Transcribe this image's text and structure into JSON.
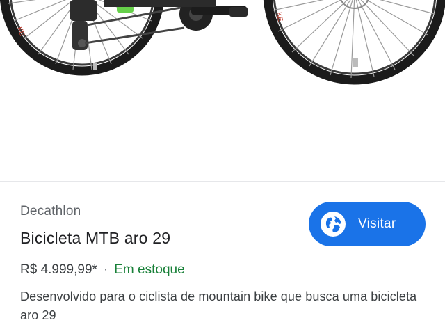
{
  "product": {
    "merchant": "Decathlon",
    "title": "Bicicleta MTB aro 29",
    "price": "R$ 4.999,99*",
    "separator": "·",
    "stock_status": "Em estoque",
    "description": "Desenvolvido para o ciclista de mountain bike que busca uma bicicleta aro 29"
  },
  "visit_button": {
    "label": "Visitar",
    "icon": "globe-icon"
  },
  "colors": {
    "accent": "#1a73e8",
    "in_stock": "#188038"
  }
}
